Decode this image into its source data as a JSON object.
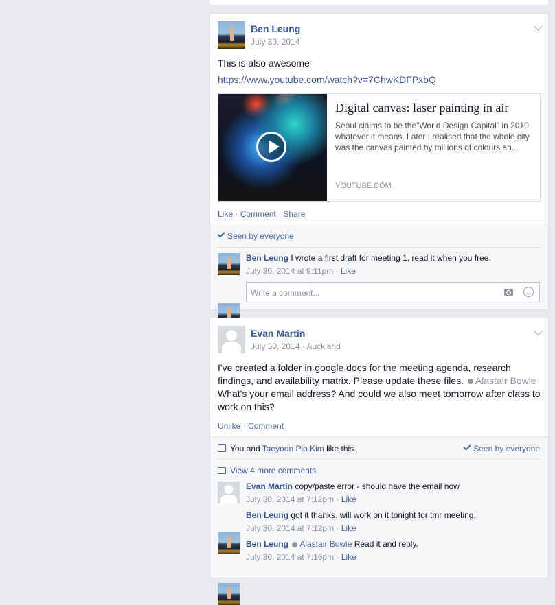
{
  "posts": [
    {
      "author": "Ben Leung",
      "date": "July 30, 2014",
      "text": "This is also awesome",
      "link": "https://www.youtube.com/watch?v=7ChwKDFPxbQ",
      "share": {
        "title": "Digital canvas: laser painting in air",
        "description": "Seoul claims to be the\"World Design Capital\" in 2010 whatever it means. Later I realised that the whole city was the canvas painted by millions of colours an...",
        "source": "YOUTUBE.COM"
      },
      "actions": {
        "like": "Like",
        "comment": "Comment",
        "share": "Share"
      },
      "seen": "Seen by everyone",
      "comments": [
        {
          "author": "Ben Leung",
          "text": "I wrote a first draft for meeting 1, read it when you free.",
          "time": "July 30, 2014 at 9:11pm",
          "like": "Like"
        }
      ],
      "write_placeholder": "Write a comment..."
    },
    {
      "author": "Evan Martin",
      "date": "July 30, 2014",
      "location": "Auckland",
      "text_part1": "I've created a folder in google docs for the meeting agenda, research findings, and availability matrix. Please update these files.",
      "mention": "Alastair Bowie",
      "text_part2": "What's your email address? And could we also meet tomorrow after class to work on this?",
      "actions": {
        "unlike": "Unlike",
        "comment": "Comment"
      },
      "likes": {
        "you": "You",
        "and": "and",
        "other": "Taeyoon Pio Kim",
        "suffix": "like this."
      },
      "seen": "Seen by everyone",
      "view_more": "View 4 more comments",
      "comments": [
        {
          "author": "Evan Martin",
          "text": "copy/paste error - should have the email now",
          "time": "July 30, 2014 at 7:12pm",
          "like": "Like"
        },
        {
          "author": "Ben Leung",
          "text": "got it thanks. will work on it tonight for tmr meeting.",
          "time": "July 30, 2014 at 7:12pm",
          "like": "Like"
        },
        {
          "author": "Ben Leung",
          "mention": "Alastair Bowie",
          "text": "Read it and reply.",
          "time": "July 30, 2014 at 7:16pm",
          "like": "Like"
        }
      ]
    }
  ]
}
